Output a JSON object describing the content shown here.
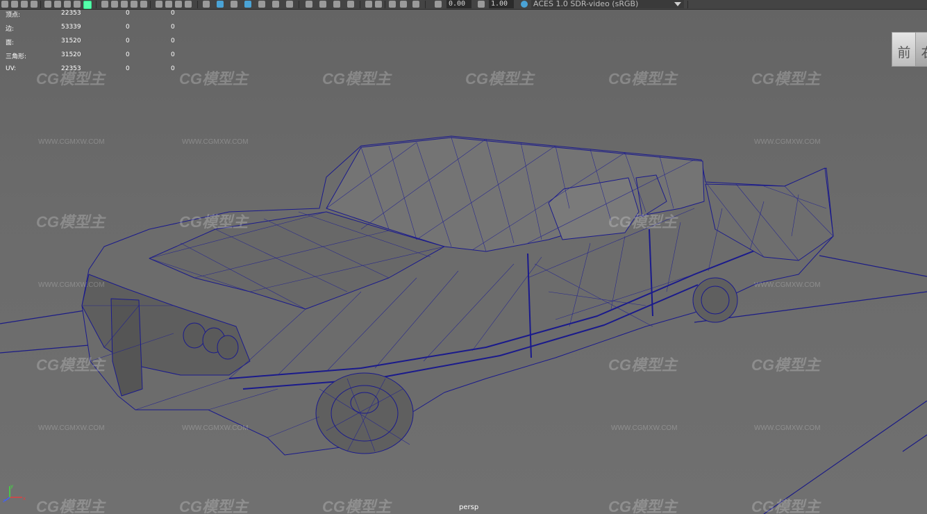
{
  "toolbar": {
    "exposure_value": "0.00",
    "gamma_value": "1.00",
    "color_space": "ACES 1.0 SDR-video (sRGB)"
  },
  "hud": {
    "rows": [
      {
        "label": "顶点:",
        "v1": "22353",
        "v2": "0",
        "v3": "0"
      },
      {
        "label": "边:",
        "v1": "53339",
        "v2": "0",
        "v3": "0"
      },
      {
        "label": "面:",
        "v1": "31520",
        "v2": "0",
        "v3": "0"
      },
      {
        "label": "三角形:",
        "v1": "31520",
        "v2": "0",
        "v3": "0"
      },
      {
        "label": "UV:",
        "v1": "22353",
        "v2": "0",
        "v3": "0"
      }
    ]
  },
  "viewcube": {
    "front": "前",
    "right": "右"
  },
  "viewport": {
    "camera_label": "persp",
    "wireframe_color": "#1a1a8c",
    "background_color": "#6a6a6a"
  },
  "watermark": {
    "logo": "CG模型主",
    "url": "WWW.CGMXW.COM"
  },
  "axis": {
    "x": "x",
    "y": "y",
    "z": "z"
  }
}
